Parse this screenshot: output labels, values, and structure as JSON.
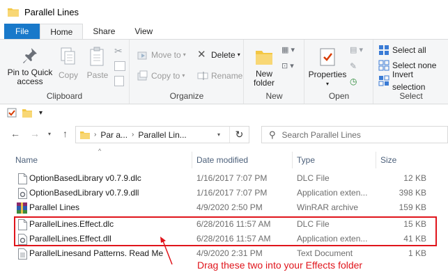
{
  "window": {
    "title": "Parallel Lines"
  },
  "tabs": [
    {
      "label": "File"
    },
    {
      "label": "Home"
    },
    {
      "label": "Share"
    },
    {
      "label": "View"
    }
  ],
  "ribbon": {
    "clipboard": {
      "label": "Clipboard",
      "pin_label_1": "Pin to Quick",
      "pin_label_2": "access",
      "copy": "Copy",
      "paste": "Paste"
    },
    "organize": {
      "label": "Organize",
      "move_to": "Move to",
      "copy_to": "Copy to",
      "delete": "Delete",
      "rename": "Rename"
    },
    "new": {
      "label": "New",
      "new_folder_1": "New",
      "new_folder_2": "folder"
    },
    "open": {
      "label": "Open",
      "properties": "Properties"
    },
    "select": {
      "label": "Select",
      "select_all": "Select all",
      "select_none": "Select none",
      "invert": "Invert selection"
    }
  },
  "address": {
    "segment1": "Par a...",
    "segment2": "Parallel Lin..."
  },
  "search": {
    "placeholder": "Search Parallel Lines"
  },
  "columns": {
    "name": "Name",
    "date": "Date modified",
    "type": "Type",
    "size": "Size"
  },
  "files": [
    {
      "name": "OptionBasedLibrary v0.7.9.dlc",
      "date": "1/16/2017 7:07 PM",
      "type": "DLC File",
      "size": "12 KB",
      "icon": "blank-file-icon"
    },
    {
      "name": "OptionBasedLibrary v0.7.9.dll",
      "date": "1/16/2017 7:07 PM",
      "type": "Application exten...",
      "size": "398 KB",
      "icon": "dll-file-icon"
    },
    {
      "name": "Parallel Lines",
      "date": "4/9/2020 2:50 PM",
      "type": "WinRAR archive",
      "size": "159 KB",
      "icon": "winrar-archive-icon"
    },
    {
      "name": "ParallelLines.Effect.dlc",
      "date": "6/28/2016 11:57 AM",
      "type": "DLC File",
      "size": "15 KB",
      "icon": "blank-file-icon"
    },
    {
      "name": "ParallelLines.Effect.dll",
      "date": "6/28/2016 11:57 AM",
      "type": "Application exten...",
      "size": "41 KB",
      "icon": "dll-file-icon"
    },
    {
      "name": "ParallelLinesand Patterns. Read Me",
      "date": "4/9/2020 2:31 PM",
      "type": "Text Document",
      "size": "1 KB",
      "icon": "text-file-icon"
    }
  ],
  "annotation": {
    "text": "Drag these two into your Effects folder",
    "color": "#e0141b"
  },
  "colors": {
    "file_tab": "#1979ca",
    "folder": "#f3c744",
    "header_text": "#4c607a"
  }
}
